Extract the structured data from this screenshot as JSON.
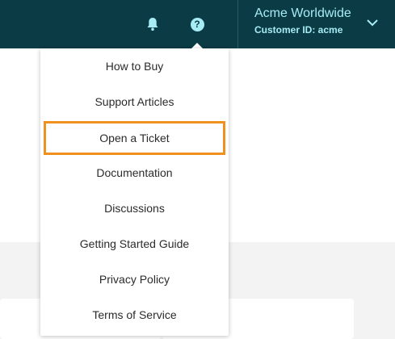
{
  "header": {
    "account_name": "Acme Worldwide",
    "customer_id": "Customer ID: acme",
    "bell_icon": "bell-icon",
    "help_icon": "help-circle-icon",
    "help_glyph": "?",
    "chevron_icon": "chevron-down-icon"
  },
  "help_menu": {
    "items": [
      {
        "label": "How to Buy"
      },
      {
        "label": "Support Articles"
      },
      {
        "label": "Open a Ticket",
        "selected": true
      },
      {
        "label": "Documentation"
      },
      {
        "label": "Discussions"
      },
      {
        "label": "Getting Started Guide"
      },
      {
        "label": "Privacy Policy"
      },
      {
        "label": "Terms of Service"
      }
    ]
  },
  "colors": {
    "topbar": "#0b3b45",
    "accent_text": "#a7ecf5",
    "highlight_border": "#f0901e"
  }
}
